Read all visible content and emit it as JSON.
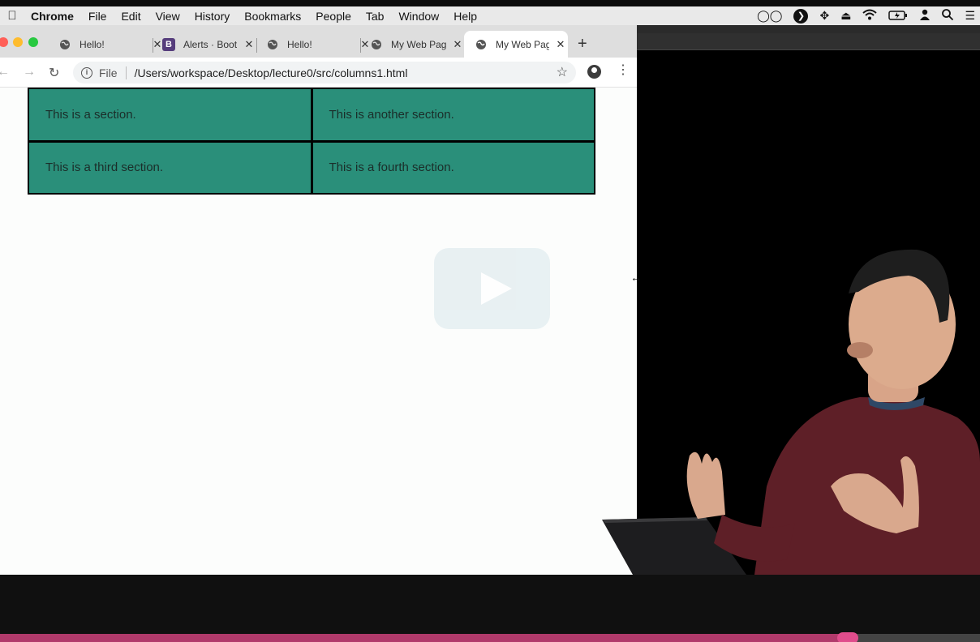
{
  "menubar": {
    "app": "Chrome",
    "items": [
      "File",
      "Edit",
      "View",
      "History",
      "Bookmarks",
      "People",
      "Tab",
      "Window",
      "Help"
    ]
  },
  "tabs": [
    {
      "title": "Hello!",
      "icon": "globe-icon"
    },
    {
      "title": "Alerts · Boot",
      "icon": "bootstrap-icon"
    },
    {
      "title": "Hello!",
      "icon": "globe-icon"
    },
    {
      "title": "My Web Pag",
      "icon": "globe-icon"
    },
    {
      "title": "My Web Pag",
      "icon": "globe-icon",
      "active": true
    }
  ],
  "omnibox": {
    "scheme": "File",
    "url": "/Users/workspace/Desktop/lecture0/src/columns1.html"
  },
  "page": {
    "sections": [
      "This is a section.",
      "This is another section.",
      "This is a third section.",
      "This is a fourth section."
    ]
  },
  "video": {
    "progress": 0.865
  },
  "colors": {
    "section_bg": "#2a8f7a",
    "progress_fill": "#b13a6b"
  }
}
